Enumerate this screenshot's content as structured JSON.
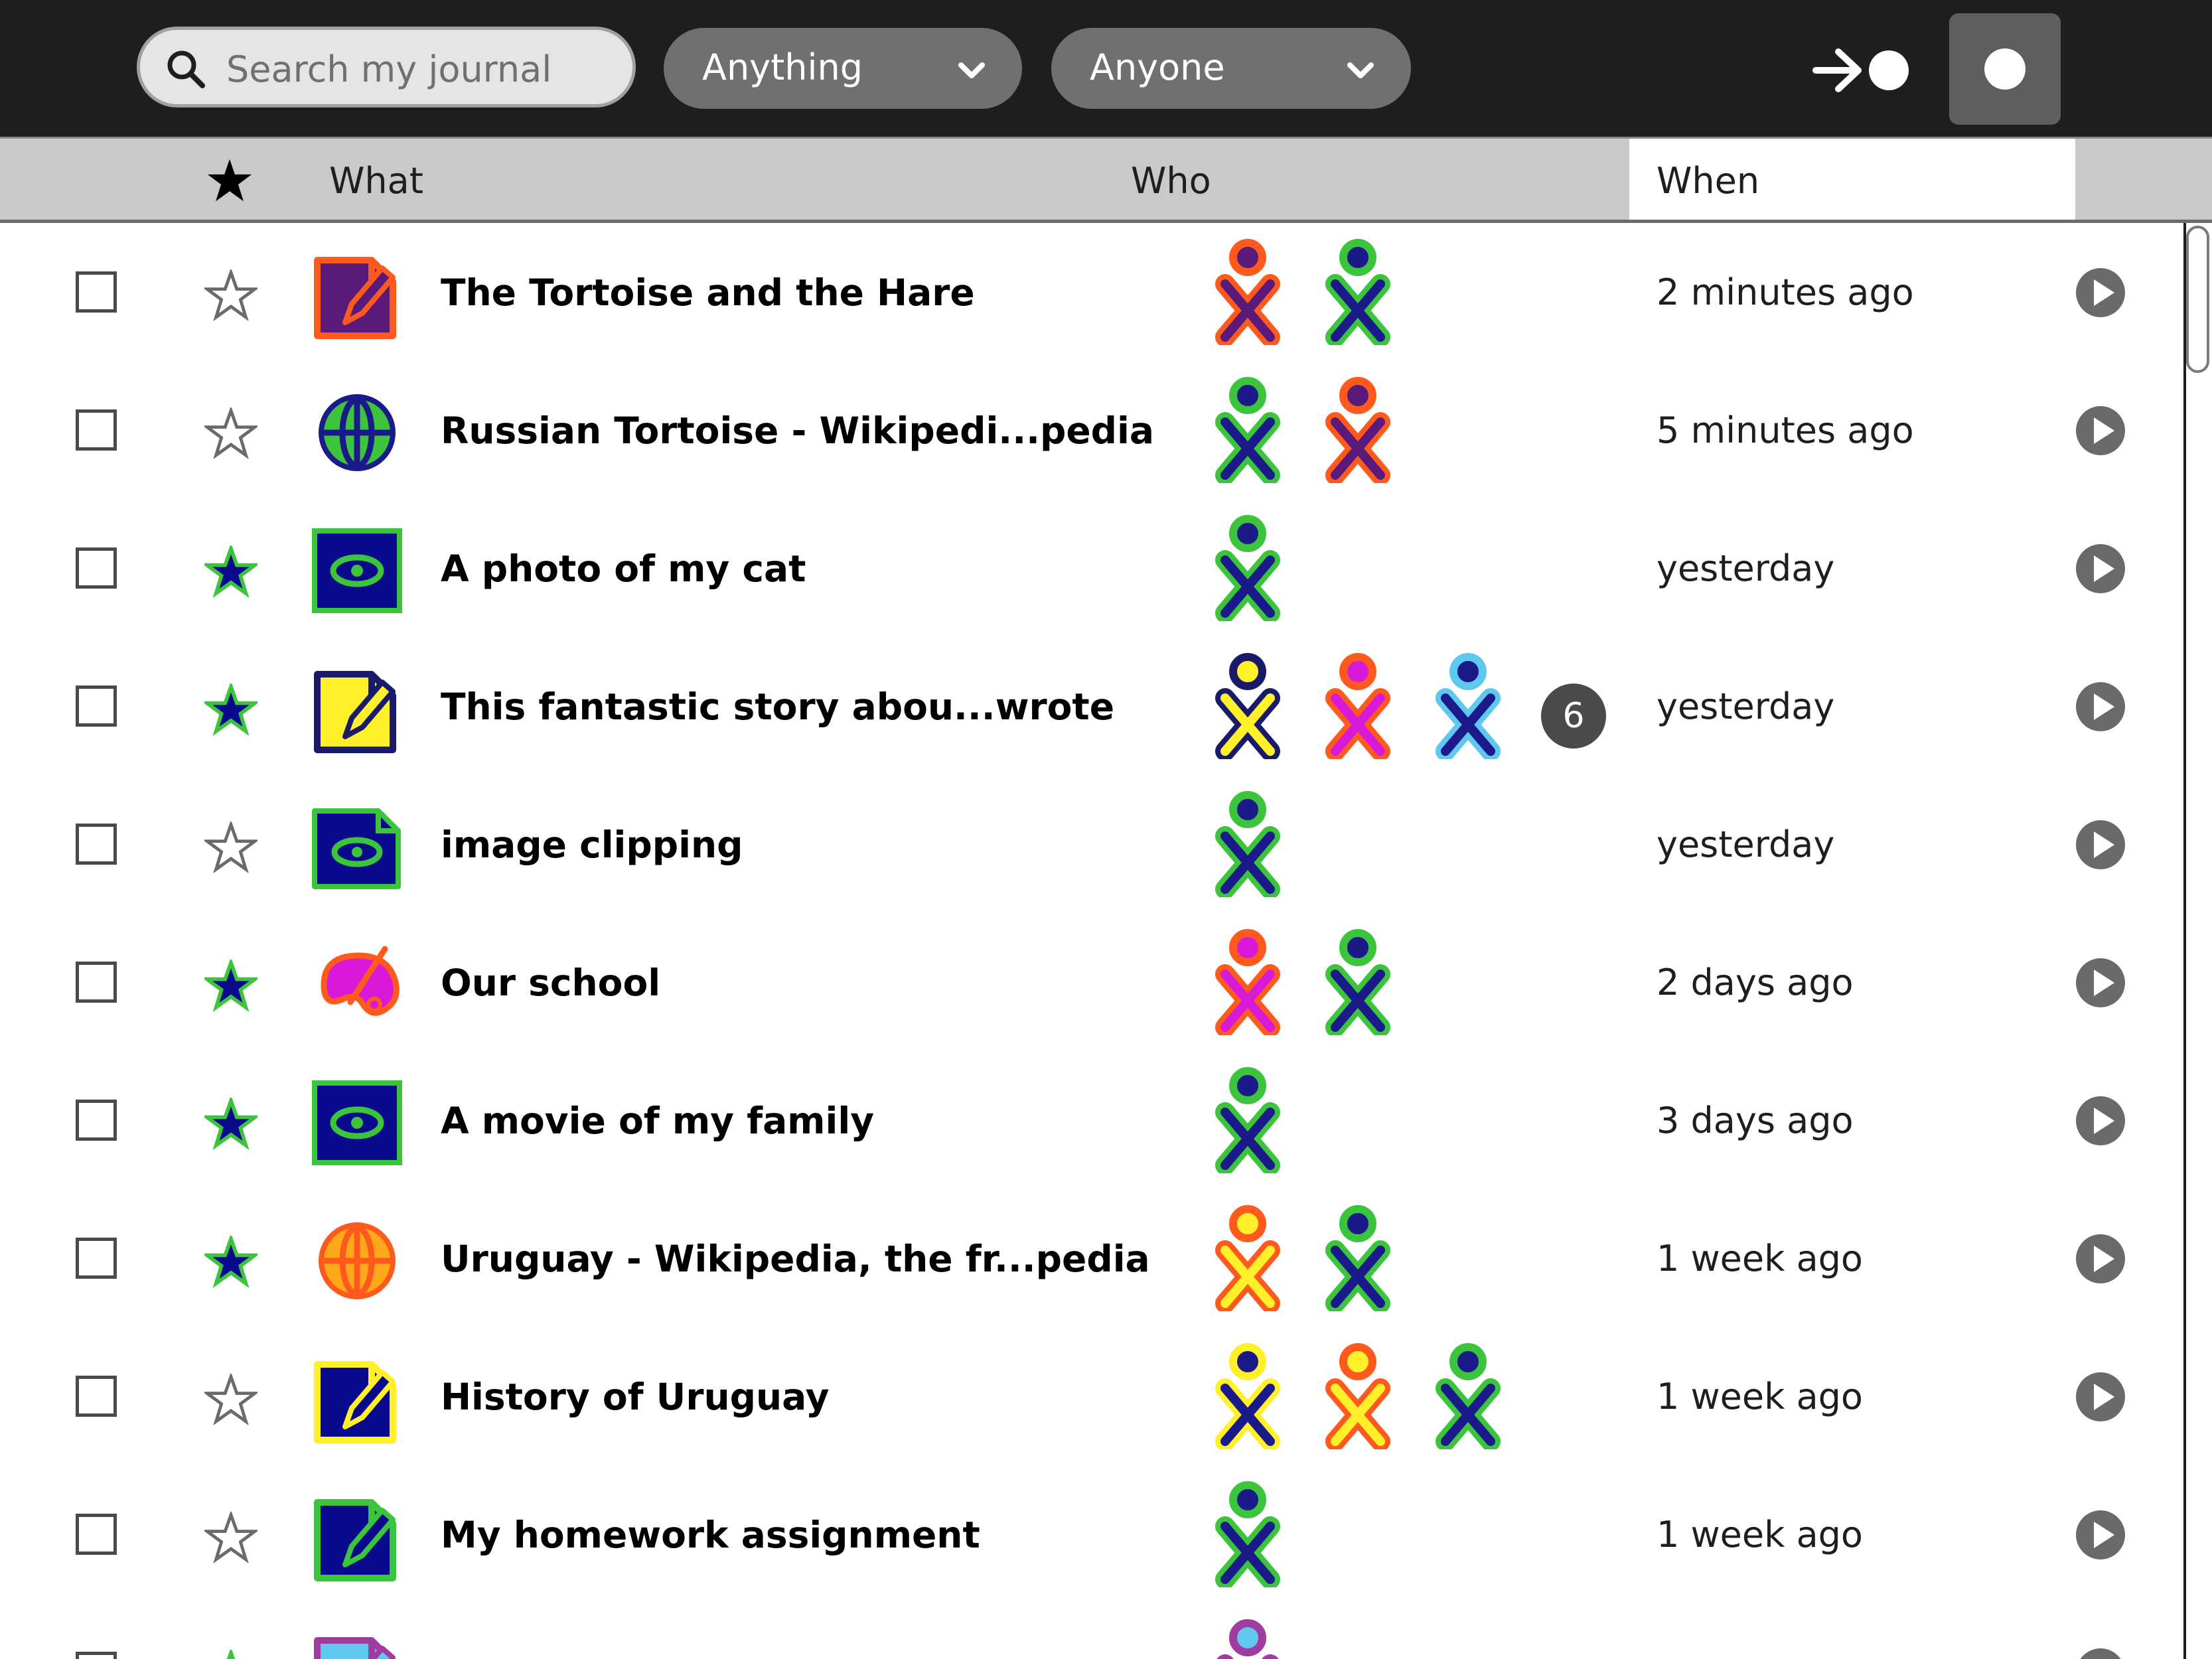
{
  "toolbar": {
    "search_placeholder": "Search my journal",
    "what_filter": "Anything",
    "who_filter": "Anyone",
    "icons": {
      "search": "search-icon",
      "what": "chevron-down-icon",
      "who": "chevron-down-icon",
      "back": "back-to-home-icon"
    }
  },
  "header": {
    "favorite_icon": "star-icon",
    "what": "What",
    "who": "Who",
    "when": "When"
  },
  "entries": [
    {
      "title": "The Tortoise and the Hare",
      "when": "2 minutes ago",
      "favorite": false,
      "icon": {
        "type": "write",
        "stroke": "#ff5a1e",
        "fill": "#5a1a7a"
      },
      "buddies": [
        {
          "stroke": "#ff5a1e",
          "fill": "#5a1a7a"
        },
        {
          "stroke": "#3cc43c",
          "fill": "#1a1a8a"
        }
      ],
      "more": ""
    },
    {
      "title": "Russian Tortoise - Wikipedi...pedia",
      "when": "5 minutes ago",
      "favorite": false,
      "icon": {
        "type": "browse",
        "stroke": "#1a1a8a",
        "fill": "#3cc43c"
      },
      "buddies": [
        {
          "stroke": "#3cc43c",
          "fill": "#1a1a8a"
        },
        {
          "stroke": "#ff5a1e",
          "fill": "#5a1a7a"
        }
      ],
      "more": ""
    },
    {
      "title": "A photo of my cat",
      "when": "yesterday",
      "favorite": true,
      "icon": {
        "type": "image",
        "stroke": "#3cc43c",
        "fill": "#0a0a8c"
      },
      "buddies": [
        {
          "stroke": "#3cc43c",
          "fill": "#1a1a8a"
        }
      ],
      "more": ""
    },
    {
      "title": "This fantastic story abou...wrote",
      "when": "yesterday",
      "favorite": true,
      "icon": {
        "type": "write",
        "stroke": "#1a1a6a",
        "fill": "#fff02a"
      },
      "buddies": [
        {
          "stroke": "#1a1a6a",
          "fill": "#fff02a"
        },
        {
          "stroke": "#ff5a1e",
          "fill": "#d81ad8"
        },
        {
          "stroke": "#5ec8f0",
          "fill": "#1a1a8a"
        }
      ],
      "more": "6"
    },
    {
      "title": "image clipping",
      "when": "yesterday",
      "favorite": false,
      "icon": {
        "type": "clip",
        "stroke": "#3cc43c",
        "fill": "#0a0a8c"
      },
      "buddies": [
        {
          "stroke": "#3cc43c",
          "fill": "#1a1a8a"
        }
      ],
      "more": ""
    },
    {
      "title": "Our school",
      "when": "2 days ago",
      "favorite": true,
      "icon": {
        "type": "paint",
        "stroke": "#ff5a1e",
        "fill": "#d81ad8"
      },
      "buddies": [
        {
          "stroke": "#ff5a1e",
          "fill": "#d81ad8"
        },
        {
          "stroke": "#3cc43c",
          "fill": "#1a1a8a"
        }
      ],
      "more": ""
    },
    {
      "title": "A movie of my family",
      "when": "3 days ago",
      "favorite": true,
      "icon": {
        "type": "image",
        "stroke": "#3cc43c",
        "fill": "#0a0a8c"
      },
      "buddies": [
        {
          "stroke": "#3cc43c",
          "fill": "#1a1a8a"
        }
      ],
      "more": ""
    },
    {
      "title": "Uruguay - Wikipedia, the fr...pedia",
      "when": "1 week ago",
      "favorite": true,
      "icon": {
        "type": "browse",
        "stroke": "#ff5a1e",
        "fill": "#ffa81a"
      },
      "buddies": [
        {
          "stroke": "#ff5a1e",
          "fill": "#fff02a"
        },
        {
          "stroke": "#3cc43c",
          "fill": "#1a1a8a"
        }
      ],
      "more": ""
    },
    {
      "title": "History of Uruguay",
      "when": "1 week ago",
      "favorite": false,
      "icon": {
        "type": "write",
        "stroke": "#fff02a",
        "fill": "#0a0a8c"
      },
      "buddies": [
        {
          "stroke": "#fff02a",
          "fill": "#1a1a8a"
        },
        {
          "stroke": "#ff5a1e",
          "fill": "#fff02a"
        },
        {
          "stroke": "#3cc43c",
          "fill": "#1a1a8a"
        }
      ],
      "more": ""
    },
    {
      "title": "My homework assignment",
      "when": "1 week ago",
      "favorite": false,
      "icon": {
        "type": "write",
        "stroke": "#3cc43c",
        "fill": "#0a0a8c"
      },
      "buddies": [
        {
          "stroke": "#3cc43c",
          "fill": "#1a1a8a"
        }
      ],
      "more": ""
    },
    {
      "title": "",
      "when": "",
      "favorite": true,
      "icon": {
        "type": "write",
        "stroke": "#a03ca0",
        "fill": "#5ec8f0"
      },
      "buddies": [
        {
          "stroke": "#a03ca0",
          "fill": "#5ec8f0"
        }
      ],
      "more": ""
    }
  ],
  "colors": {
    "toolbar_bg": "#1e1e1e",
    "header_bg": "#c8c9cb",
    "favorite_star_fill": "#0a0a8c",
    "favorite_star_stroke": "#3cc43c"
  }
}
